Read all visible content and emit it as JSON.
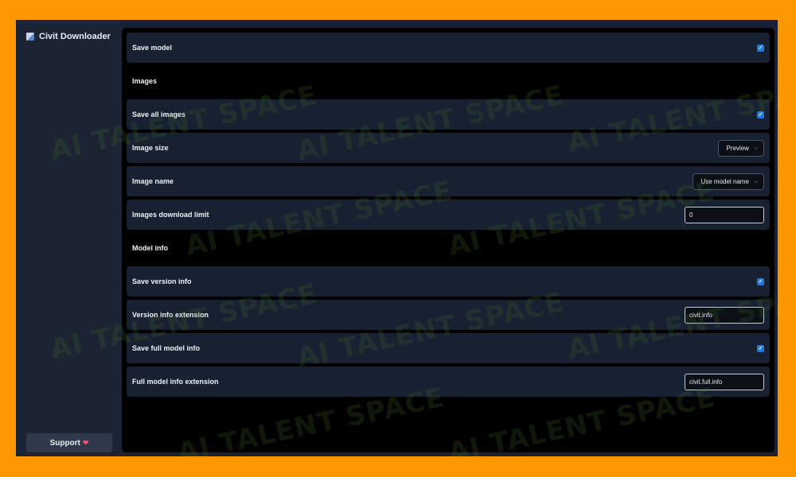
{
  "app": {
    "title": "Civit Downloader",
    "support_label": "Support",
    "support_icon": "heart-icon"
  },
  "settings": {
    "save_model": {
      "label": "Save model",
      "checked": true
    },
    "images_section": "Images",
    "save_all_images": {
      "label": "Save all images",
      "checked": true
    },
    "image_size": {
      "label": "Image size",
      "value": "Preview"
    },
    "image_name": {
      "label": "Image name",
      "value": "Use model name"
    },
    "images_download_limit": {
      "label": "Images download limit",
      "value": "0"
    },
    "model_info_section": "Model info",
    "save_version_info": {
      "label": "Save version info",
      "checked": true
    },
    "version_info_extension": {
      "label": "Version info extension",
      "value": "civit.info"
    },
    "save_full_model_info": {
      "label": "Save full model info",
      "checked": true
    },
    "full_model_info_extension": {
      "label": "Full model info extension",
      "value": "civit.full.info"
    }
  },
  "watermark": "AI TALENT SPACE",
  "colors": {
    "outer_background": "#ff9800",
    "sidebar": "#1c2434",
    "content_background": "#000000",
    "row_background": "#182131",
    "checkbox_accent": "#1f7ae0"
  }
}
